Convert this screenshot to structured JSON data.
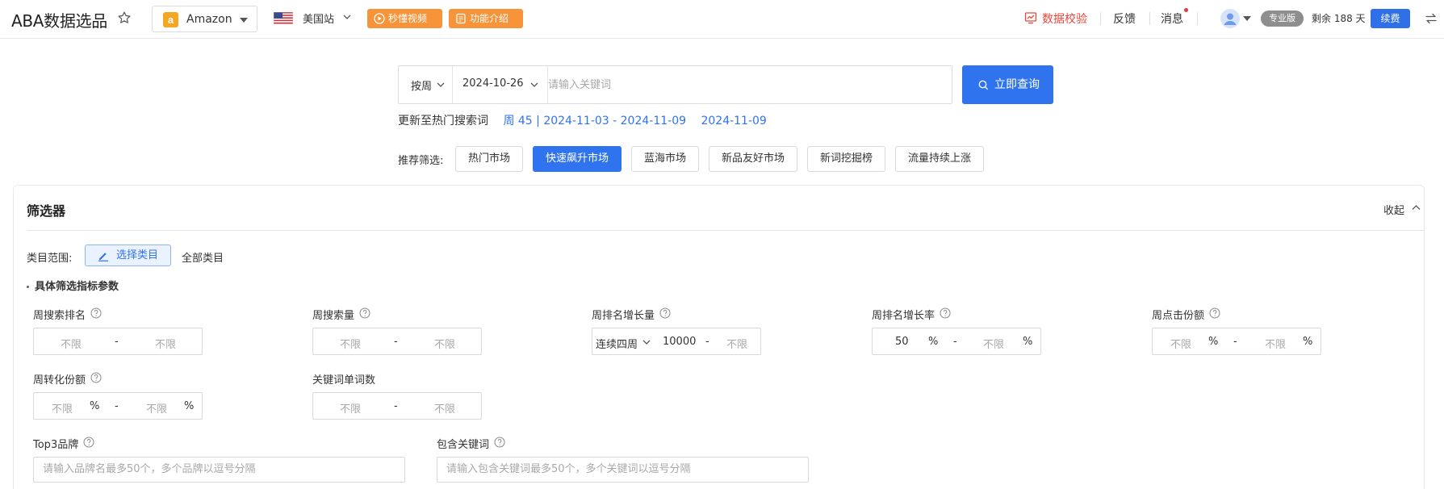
{
  "header": {
    "app_title": "ABA数据选品",
    "market": "Amazon",
    "market_logo": "a",
    "site": "美国站",
    "video_btn": "秒懂视频",
    "intro_btn": "功能介绍",
    "data_check": "数据校验",
    "feedback": "反馈",
    "messages": "消息",
    "plan_badge": "专业版",
    "remaining": "剩余 188 天",
    "renew": "续费"
  },
  "search": {
    "period": "按周",
    "date": "2024-10-26",
    "placeholder": "请输入关键词",
    "query_btn": "立即查询"
  },
  "update_info": {
    "label": "更新至热门搜索词",
    "week_range": "周 45 | 2024-11-03 - 2024-11-09",
    "date": "2024-11-09"
  },
  "recommend": {
    "label": "推荐筛选:",
    "items": [
      {
        "label": "热门市场",
        "active": false
      },
      {
        "label": "快速飙升市场",
        "active": true
      },
      {
        "label": "蓝海市场",
        "active": false
      },
      {
        "label": "新品友好市场",
        "active": false
      },
      {
        "label": "新词挖掘榜",
        "active": false
      },
      {
        "label": "流量持续上涨",
        "active": false
      }
    ]
  },
  "filter": {
    "title": "筛选器",
    "collapse": "收起",
    "category_label": "类目范围:",
    "category_btn": "选择类目",
    "category_value": "全部类目",
    "param_title": "具体筛选指标参数",
    "unlimited": "不限",
    "dash": "-",
    "percent": "%",
    "fields": {
      "weekly_rank": {
        "label": "周搜索排名"
      },
      "weekly_volume": {
        "label": "周搜索量"
      },
      "rank_growth": {
        "label": "周排名增长量",
        "period": "连续四周",
        "min": "10000"
      },
      "rank_growth_rate": {
        "label": "周排名增长率",
        "min": "50"
      },
      "click_share": {
        "label": "周点击份额"
      },
      "conversion_share": {
        "label": "周转化份额"
      },
      "keyword_word_count": {
        "label": "关键词单词数"
      },
      "top3_brand": {
        "label": "Top3品牌",
        "placeholder": "请输入品牌名最多50个，多个品牌以逗号分隔"
      },
      "include_keywords": {
        "label": "包含关键词",
        "placeholder": "请输入包含关键词最多50个，多个关键词以逗号分隔"
      }
    }
  },
  "colors": {
    "primary": "#2f73ef",
    "orange": "#f7943a",
    "red": "#e8463a",
    "badge_gray": "#8e8e8e"
  }
}
